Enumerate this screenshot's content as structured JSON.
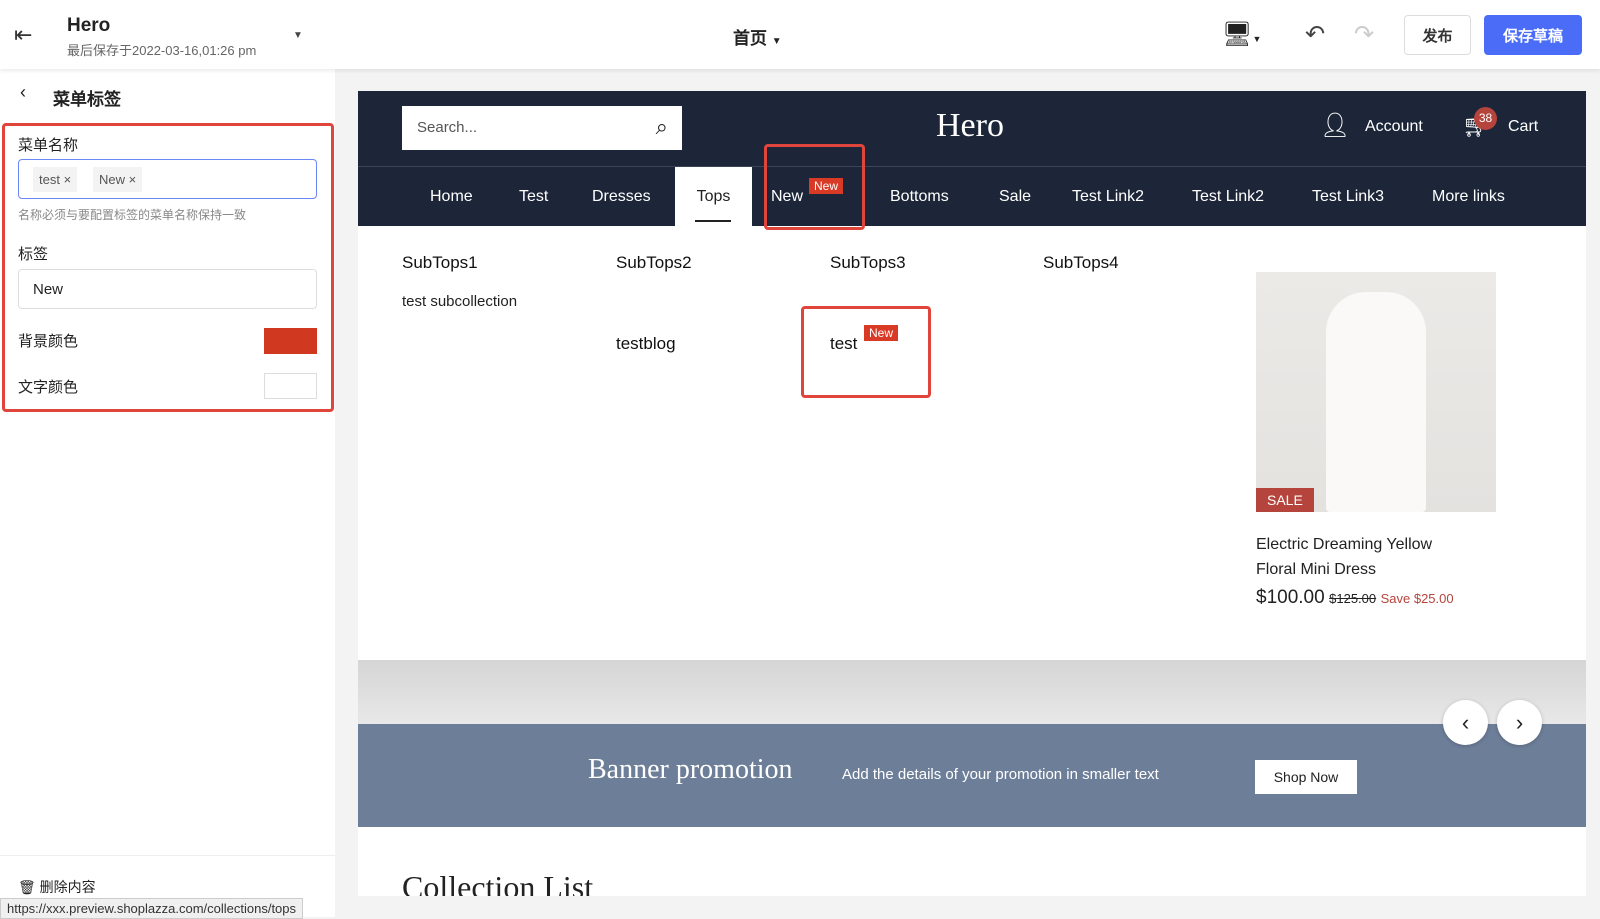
{
  "topbar": {
    "title": "Hero",
    "saved": "最后保存于2022-03-16,01:26 pm",
    "page_select": "首页",
    "publish": "发布",
    "save_draft": "保存草稿"
  },
  "panel": {
    "back_title": "菜单标签",
    "menu_name_label": "菜单名称",
    "menu_tags": [
      "test",
      "New"
    ],
    "hint": "名称必须与要配置标签的菜单名称保持一致",
    "tag_label": "标签",
    "tag_value": "New",
    "bg_color_label": "背景颜色",
    "bg_color": "#d0391f",
    "text_color_label": "文字颜色",
    "text_color": "#ffffff",
    "delete": "删除内容"
  },
  "status_url": "https://xxx.preview.shoplazza.com/collections/tops",
  "store": {
    "search_placeholder": "Search...",
    "logo": "Hero",
    "account": "Account",
    "cart": "Cart",
    "cart_count": "38",
    "nav": [
      "Home",
      "Test",
      "Dresses",
      "Tops",
      "New",
      "Bottoms",
      "Sale",
      "Test Link2",
      "Test Link2",
      "Test Link3",
      "More links"
    ],
    "active_nav": "Tops",
    "nav_badge": "New",
    "menu": {
      "cols": [
        "SubTops1",
        "SubTops2",
        "SubTops3",
        "SubTops4"
      ],
      "sub1": "test subcollection",
      "sub2": "testblog",
      "sub3": "test",
      "sub3_badge": "New"
    },
    "product": {
      "badge": "SALE",
      "name_line1": "Electric Dreaming Yellow",
      "name_line2": "Floral Mini Dress",
      "price": "$100.00",
      "compare": "$125.00",
      "save": "Save $25.00"
    },
    "banner": {
      "title": "Banner promotion",
      "text": "Add the details of your promotion in smaller text",
      "button": "Shop Now"
    },
    "collection_title": "Collection List"
  }
}
